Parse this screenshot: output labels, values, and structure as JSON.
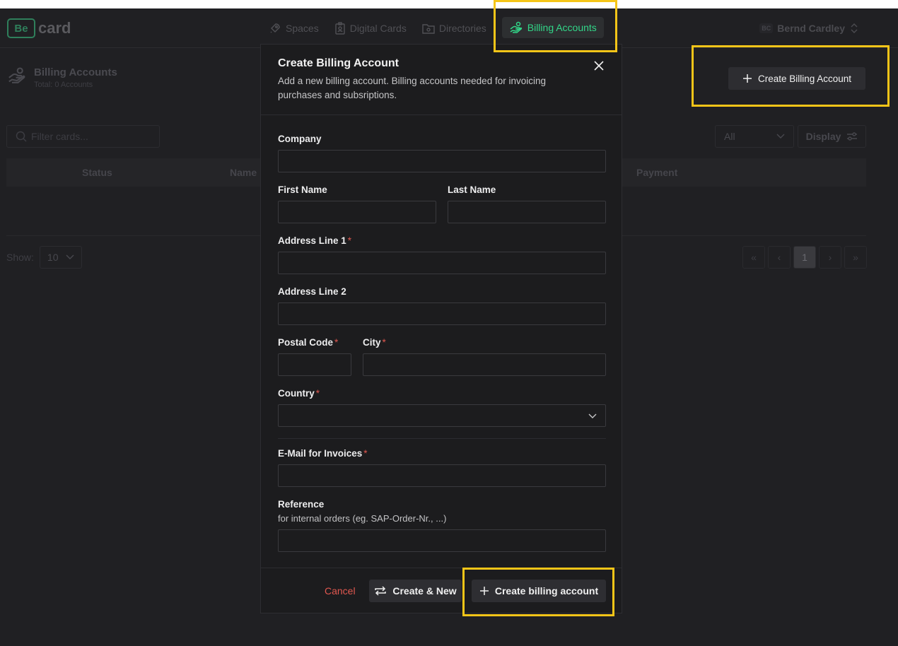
{
  "logo": {
    "mark": "Be",
    "text": "card"
  },
  "nav": {
    "items": [
      {
        "label": "Spaces",
        "icon": "rocket-icon"
      },
      {
        "label": "Digital Cards",
        "icon": "badge-icon"
      },
      {
        "label": "Directories",
        "icon": "folder-icon"
      }
    ],
    "active": {
      "label": "Billing Accounts",
      "icon": "billing-hand-icon"
    }
  },
  "user": {
    "initials": "BC",
    "name": "Bernd Cardley"
  },
  "page": {
    "title": "Billing Accounts",
    "subtitle": "Total: 0 Accounts",
    "create_label": "Create Billing Account"
  },
  "toolbar": {
    "filter_placeholder": "Filter cards...",
    "status_filter": "All",
    "display_label": "Display"
  },
  "table": {
    "headers": {
      "status": "Status",
      "name": "Name",
      "payment": "Payment"
    }
  },
  "pagination": {
    "show_label": "Show:",
    "page_size": "10",
    "current_page": "1"
  },
  "modal": {
    "title": "Create Billing Account",
    "description": "Add a new billing account. Billing accounts needed for invoicing purchases and subsriptions.",
    "fields": {
      "company": "Company",
      "first_name": "First Name",
      "last_name": "Last Name",
      "address1": "Address Line 1",
      "address2": "Address Line 2",
      "postal_code": "Postal Code",
      "city": "City",
      "country": "Country",
      "email": "E-Mail for Invoices",
      "reference": "Reference",
      "reference_hint": "for internal orders (eg. SAP-Order-Nr., ...)"
    },
    "required_mark": "*",
    "footer": {
      "cancel": "Cancel",
      "create_new": "Create & New",
      "create": "Create billing account"
    }
  },
  "colors": {
    "accent": "#32d789",
    "highlight": "#f5c518",
    "danger": "#e0574f",
    "brand": "#2f7f5b"
  }
}
